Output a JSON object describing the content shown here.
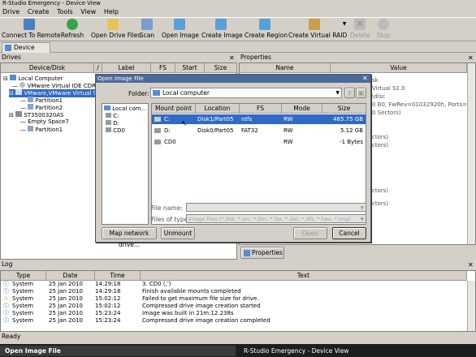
{
  "window": {
    "title": "R-Studio Emergency - Device View"
  },
  "menu": [
    "Drive",
    "Create",
    "Tools",
    "View",
    "Help"
  ],
  "toolbar": {
    "connect": "Connect To Remote",
    "refresh": "Refresh",
    "open_drive_files": "Open Drive Files",
    "scan": "Scan",
    "open_image": "Open Image",
    "create_image": "Create Image",
    "create_region": "Create Region",
    "create_virtual_raid": "Create Virtual RAID",
    "delete": "Delete",
    "stop": "Stop"
  },
  "tabs": {
    "device_view": "Device view"
  },
  "drives": {
    "title": "Drives",
    "columns": [
      "Device/Disk",
      "/",
      "Label",
      "FS",
      "Start",
      "Size"
    ],
    "tree": [
      "Local Computer",
      "VMware Virtual IDE CDRO",
      "VMware,VMware Virtual S",
      "Partition1",
      "Partition2",
      "ST3500320AS",
      "Empty Space7",
      "Partition1"
    ]
  },
  "properties": {
    "title": "Properties",
    "columns": [
      "Name",
      "Value"
    ],
    "values": [
      "sk",
      "Virtual S1.0",
      "\\disc",
      "0 B0, FwRev=01032920h, Ports=1,...",
      "0 Sectors)",
      "ctors)",
      "ctors)",
      "ctors)",
      "ctors)"
    ],
    "button": "Properties"
  },
  "dialog": {
    "title": "Open Image File",
    "folder_label": "Folder:",
    "folder_value": "Local computer",
    "left_tree": [
      "Local com...",
      "C:",
      "D:",
      "CD0"
    ],
    "columns": [
      "Mount point",
      "Location",
      "FS",
      "Mode",
      "Size"
    ],
    "rows": [
      {
        "mount": "C:",
        "location": "Disk1/Part05",
        "fs": "ntfs",
        "mode": "RW",
        "size": "465.75 GB"
      },
      {
        "mount": "D:",
        "location": "Disk0/Part05",
        "fs": "FAT32",
        "mode": "RW",
        "size": "5.12 GB"
      },
      {
        "mount": "CD0",
        "location": "",
        "fs": "",
        "mode": "RW",
        "size": "-1 Bytes"
      }
    ],
    "file_name_label": "File name:",
    "files_type_label": "Files of type:",
    "files_type_value": "Image files (*.dsk, *.arc, *.bin, *.fsx, *.dat, *.dfs, *.hex, *.img)",
    "map_network": "Map network drive...",
    "unmount": "Unmount",
    "open": "Open",
    "cancel": "Cancel"
  },
  "log": {
    "title": "Log",
    "columns": [
      "Type",
      "Date",
      "Time",
      "Text"
    ],
    "rows": [
      {
        "type": "System",
        "date": "25 Jan 2010",
        "time": "14:29:18",
        "text": "3. CD0 (,')"
      },
      {
        "type": "System",
        "date": "25 Jan 2010",
        "time": "14:29:18",
        "text": "Finish available mounts completed"
      },
      {
        "type": "System",
        "date": "25 Jan 2010",
        "time": "15:02:12",
        "text": "Failed to get maximum file size for drive."
      },
      {
        "type": "System",
        "date": "25 Jan 2010",
        "time": "15:02:12",
        "text": "Compressed drive image creation started"
      },
      {
        "type": "System",
        "date": "25 Jan 2010",
        "time": "15:23:24",
        "text": "Image was built in 21m:12.238s"
      },
      {
        "type": "System",
        "date": "25 Jan 2010",
        "time": "15:23:24",
        "text": "Compressed drive image creation completed"
      }
    ]
  },
  "status": "Ready",
  "taskbar": {
    "left": "Open Image File",
    "right": "R-Studio Emergency - Device View"
  }
}
